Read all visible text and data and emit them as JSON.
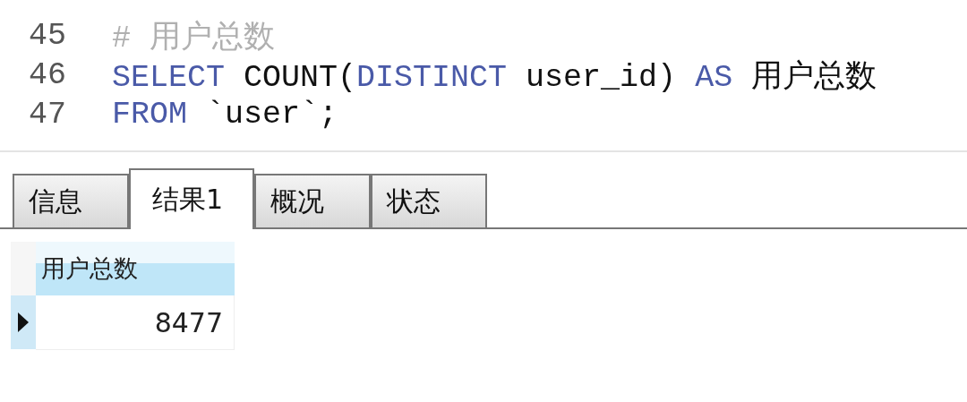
{
  "editor": {
    "lines": [
      {
        "number": "45",
        "tokens": [
          {
            "kind": "comment",
            "text": "# 用户总数"
          }
        ]
      },
      {
        "number": "46",
        "tokens": [
          {
            "kind": "keyword",
            "text": "SELECT"
          },
          {
            "kind": "plain",
            "text": " COUNT("
          },
          {
            "kind": "keyword",
            "text": "DISTINCT"
          },
          {
            "kind": "plain",
            "text": " user_id) "
          },
          {
            "kind": "keyword",
            "text": "AS"
          },
          {
            "kind": "plain",
            "text": " 用户总数"
          }
        ]
      },
      {
        "number": "47",
        "tokens": [
          {
            "kind": "keyword",
            "text": "FROM"
          },
          {
            "kind": "plain",
            "text": " `user`;"
          }
        ]
      }
    ]
  },
  "tabs": [
    {
      "label": "信息",
      "selected": false
    },
    {
      "label": "结果1",
      "selected": true
    },
    {
      "label": "概况",
      "selected": false
    },
    {
      "label": "状态",
      "selected": false
    }
  ],
  "table": {
    "columns": [
      "用户总数"
    ],
    "rows": [
      {
        "selected": true,
        "cells": [
          "8477"
        ]
      }
    ]
  }
}
